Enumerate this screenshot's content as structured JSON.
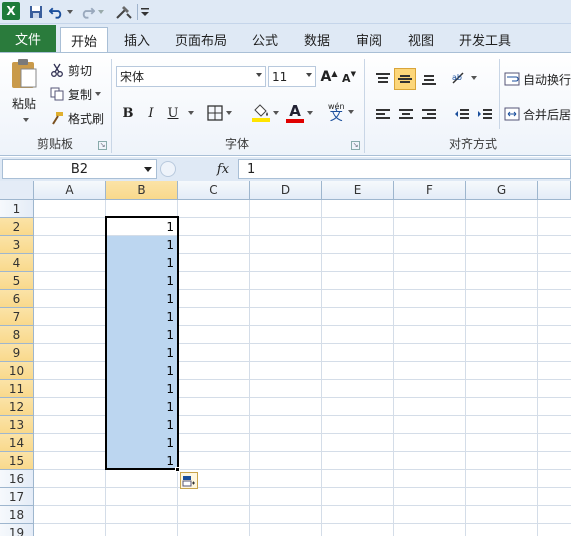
{
  "quick_access": {
    "icons": [
      "excel-logo",
      "save-icon",
      "undo-icon",
      "redo-icon",
      "customize-icon"
    ]
  },
  "tabs": [
    {
      "label": "文件"
    },
    {
      "label": "开始"
    },
    {
      "label": "插入"
    },
    {
      "label": "页面布局"
    },
    {
      "label": "公式"
    },
    {
      "label": "数据"
    },
    {
      "label": "审阅"
    },
    {
      "label": "视图"
    },
    {
      "label": "开发工具"
    }
  ],
  "ribbon": {
    "clipboard": {
      "paste_label": "粘贴",
      "cut_label": "剪切",
      "copy_label": "复制",
      "format_painter_label": "格式刷",
      "group_label": "剪贴板"
    },
    "font": {
      "font_name": "宋体",
      "font_size": "11",
      "bold": "B",
      "italic": "I",
      "underline": "U",
      "font_color_glyph": "A",
      "wen_glyph": "wén",
      "wen_char": "文",
      "group_label": "字体"
    },
    "alignment": {
      "wrap_text_label": "自动换行",
      "merge_center_label": "合并后居",
      "group_label": "对齐方式"
    }
  },
  "formula_bar": {
    "cell_ref": "B2",
    "fx_label": "fx",
    "value": "1"
  },
  "sheet": {
    "columns": [
      "A",
      "B",
      "C",
      "D",
      "E",
      "F",
      "G"
    ],
    "rows": [
      "1",
      "2",
      "3",
      "4",
      "5",
      "6",
      "7",
      "8",
      "9",
      "10",
      "11",
      "12",
      "13",
      "14",
      "15",
      "16",
      "17",
      "18",
      "19"
    ],
    "column_b_values": [
      "1",
      "1",
      "1",
      "1",
      "1",
      "1",
      "1",
      "1",
      "1",
      "1",
      "1",
      "1",
      "1",
      "1"
    ]
  }
}
